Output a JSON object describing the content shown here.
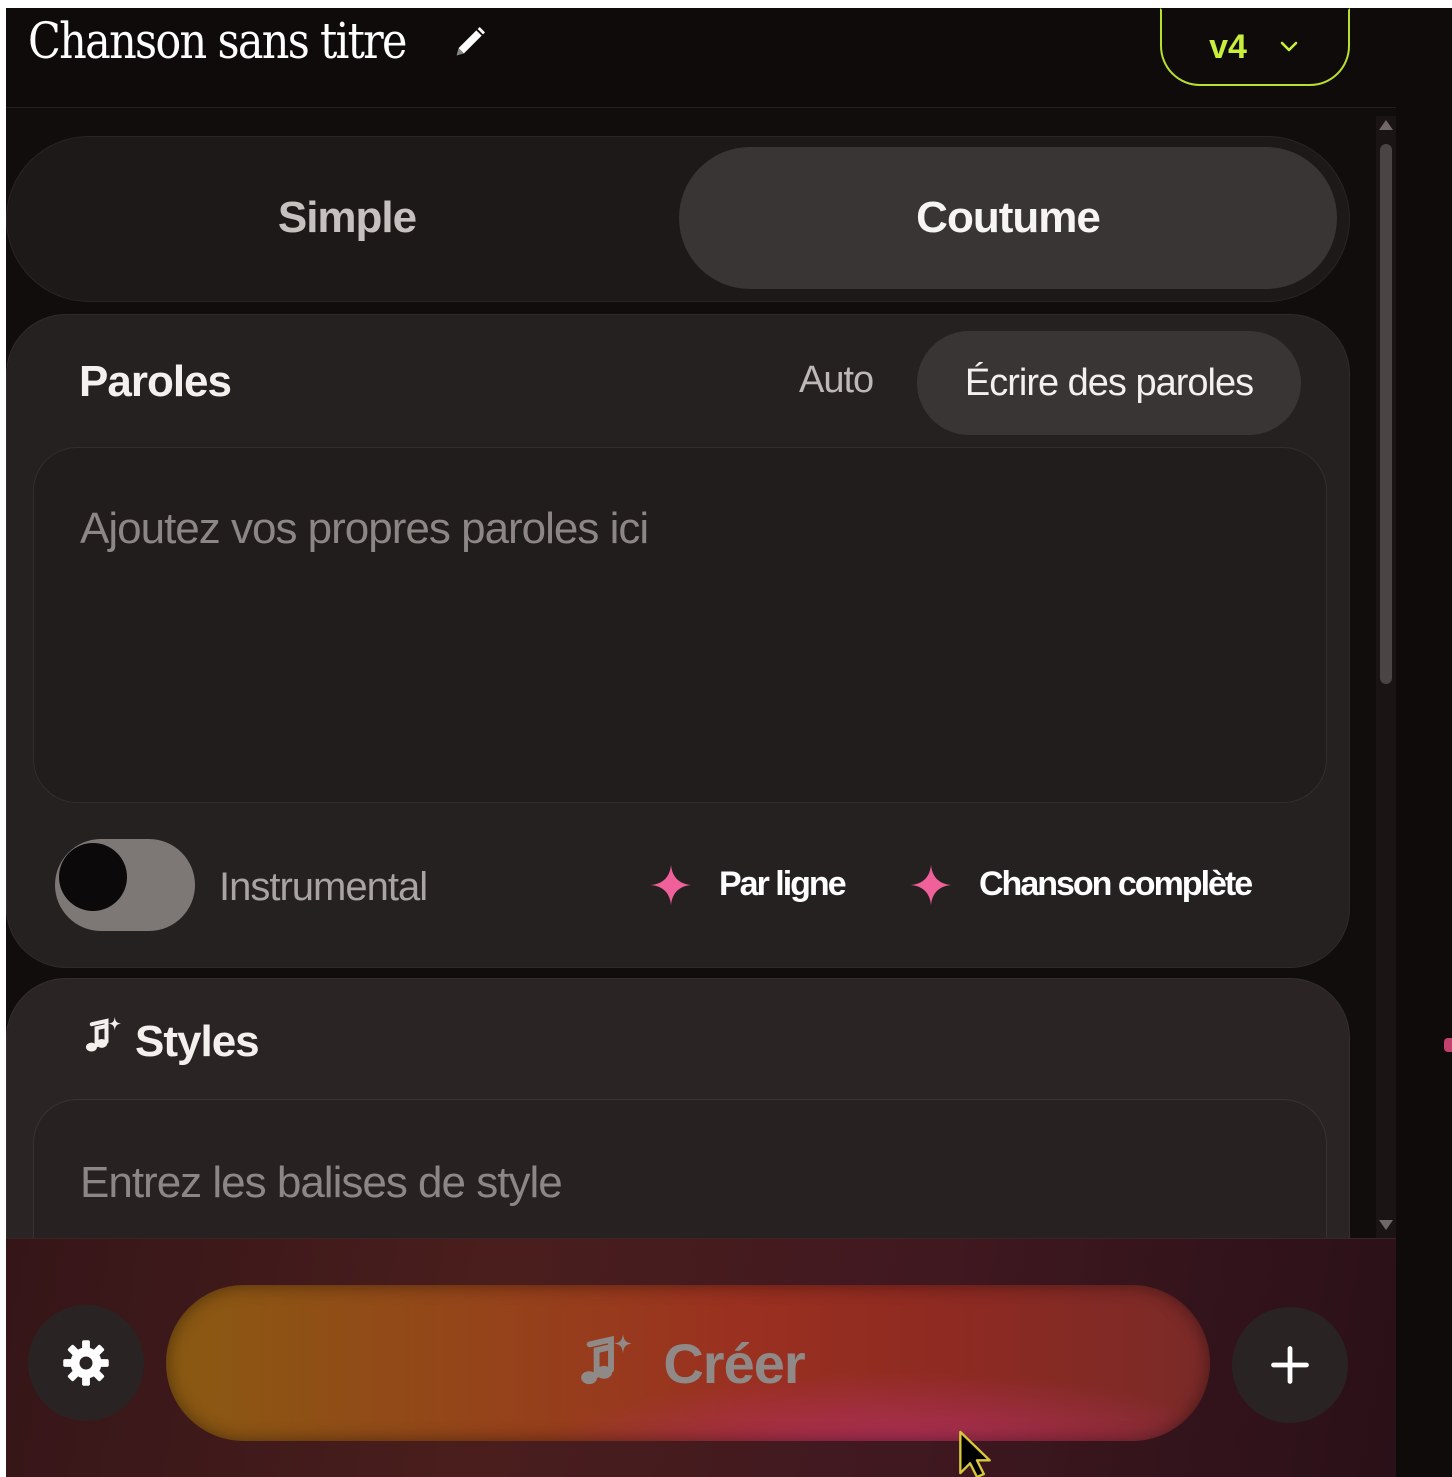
{
  "header": {
    "song_title": "Chanson sans titre",
    "version_label": "v4"
  },
  "mode": {
    "simple_label": "Simple",
    "custom_label": "Coutume",
    "selected": "Coutume"
  },
  "lyrics": {
    "title": "Paroles",
    "auto_label": "Auto",
    "write_label": "Écrire des paroles",
    "placeholder": "Ajoutez vos propres paroles ici",
    "instrumental_label": "Instrumental",
    "instrumental_on": false,
    "per_line_label": "Par ligne",
    "full_song_label": "Chanson complète"
  },
  "styles": {
    "title": "Styles",
    "placeholder": "Entrez les balises de style"
  },
  "footer": {
    "create_label": "Créer"
  },
  "colors": {
    "accent_green": "#c8f03a",
    "sparkle_pink": "#f0609a",
    "panel_bg": "#262121"
  },
  "icons": {
    "edit": "pencil-icon",
    "version_chevron": "chevron-down-icon",
    "sparkle": "sparkle-icon",
    "styles": "music-note-sparkle-icon",
    "settings": "gear-icon",
    "add": "plus-icon"
  }
}
